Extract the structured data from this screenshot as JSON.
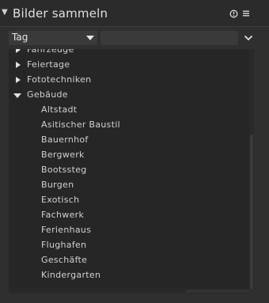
{
  "header": {
    "collapse_icon": "triangle-down",
    "title": "Bilder sammeln",
    "reset_icon": "reset-icon",
    "menu_icon": "hamburger-icon"
  },
  "filter": {
    "property": "Tag",
    "search_value": "",
    "options_icon": "chevron-down-icon"
  },
  "tree": {
    "items": [
      {
        "label": "Fahrzeuge",
        "level": 0,
        "state": "collapsed"
      },
      {
        "label": "Feiertage",
        "level": 0,
        "state": "collapsed"
      },
      {
        "label": "Fototechniken",
        "level": 0,
        "state": "collapsed"
      },
      {
        "label": "Gebäude",
        "level": 0,
        "state": "expanded"
      },
      {
        "label": "Altstadt",
        "level": 1,
        "state": "leaf"
      },
      {
        "label": "Asitischer Baustil",
        "level": 1,
        "state": "leaf"
      },
      {
        "label": "Bauernhof",
        "level": 1,
        "state": "leaf"
      },
      {
        "label": "Bergwerk",
        "level": 1,
        "state": "leaf"
      },
      {
        "label": "Bootssteg",
        "level": 1,
        "state": "leaf"
      },
      {
        "label": "Burgen",
        "level": 1,
        "state": "leaf"
      },
      {
        "label": "Exotisch",
        "level": 1,
        "state": "leaf"
      },
      {
        "label": "Fachwerk",
        "level": 1,
        "state": "leaf"
      },
      {
        "label": "Ferienhaus",
        "level": 1,
        "state": "leaf"
      },
      {
        "label": "Flughafen",
        "level": 1,
        "state": "leaf"
      },
      {
        "label": "Geschäfte",
        "level": 1,
        "state": "leaf"
      },
      {
        "label": "Kindergarten",
        "level": 1,
        "state": "leaf"
      }
    ]
  }
}
